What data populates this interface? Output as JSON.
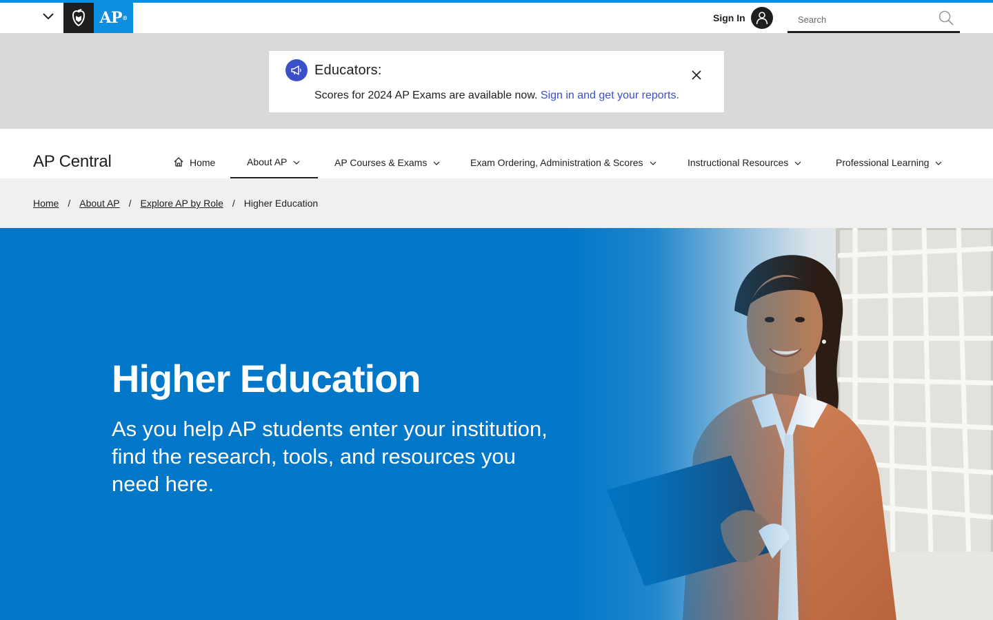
{
  "global_bar": {
    "logo_text": "AP",
    "sign_in_label": "Sign In",
    "search_placeholder": "Search"
  },
  "alert": {
    "title": "Educators:",
    "body_text": "Scores for 2024 AP Exams are available now. ",
    "link_text": "Sign in and get your reports."
  },
  "site_nav": {
    "site_title": "AP Central",
    "items": [
      {
        "label": "Home"
      },
      {
        "label": "About AP"
      },
      {
        "label": "AP Courses & Exams"
      },
      {
        "label": "Exam Ordering, Administration & Scores"
      },
      {
        "label": "Instructional Resources"
      },
      {
        "label": "Professional Learning"
      }
    ]
  },
  "breadcrumb": {
    "items": [
      "Home",
      "About AP",
      "Explore AP by Role",
      "Higher Education"
    ],
    "separator": "/"
  },
  "hero": {
    "title": "Higher Education",
    "subtitle": "As you help AP students enter your institution, find the research, tools, and resources you need here."
  },
  "colors": {
    "brand_blue": "#0077c8",
    "top_accent": "#0d8ee0",
    "link_blue": "#3a4fc8"
  }
}
